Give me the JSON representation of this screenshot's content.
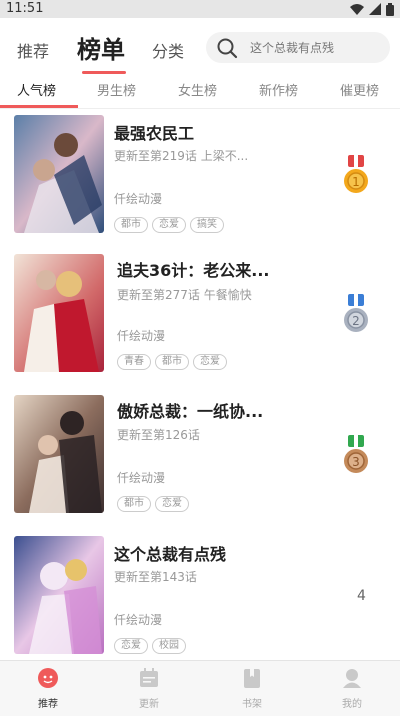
{
  "status_bar": {
    "time": "11:51"
  },
  "top_nav": {
    "tabs": [
      "推荐",
      "榜单",
      "分类"
    ],
    "active": "榜单",
    "search_placeholder": "这个总裁有点残"
  },
  "sub_tabs": {
    "items": [
      "人气榜",
      "男生榜",
      "女生榜",
      "新作榜",
      "催更榜"
    ],
    "active": "人气榜"
  },
  "colors": {
    "accent": "#ef5a5a"
  },
  "list": [
    {
      "title": "最强农民工",
      "update": "更新至第219话 上梁不...",
      "author": "仟绘动漫",
      "tags": [
        "都市",
        "恋爱",
        "搞笑"
      ],
      "rank": "1",
      "medal": "gold"
    },
    {
      "title": "追夫36计：老公来...",
      "update": "更新至第277话 午餐愉快",
      "author": "仟绘动漫",
      "tags": [
        "青春",
        "都市",
        "恋爱"
      ],
      "rank": "2",
      "medal": "silver"
    },
    {
      "title": "傲娇总裁：一纸协...",
      "update": "更新至第126话",
      "author": "仟绘动漫",
      "tags": [
        "都市",
        "恋爱"
      ],
      "rank": "3",
      "medal": "bronze"
    },
    {
      "title": "这个总裁有点残",
      "update": "更新至第143话",
      "author": "仟绘动漫",
      "tags": [
        "恋爱",
        "校园"
      ],
      "rank": "4",
      "medal": "none"
    }
  ],
  "bottom_nav": {
    "items": [
      "推荐",
      "更新",
      "书架",
      "我的"
    ],
    "active": "推荐"
  }
}
